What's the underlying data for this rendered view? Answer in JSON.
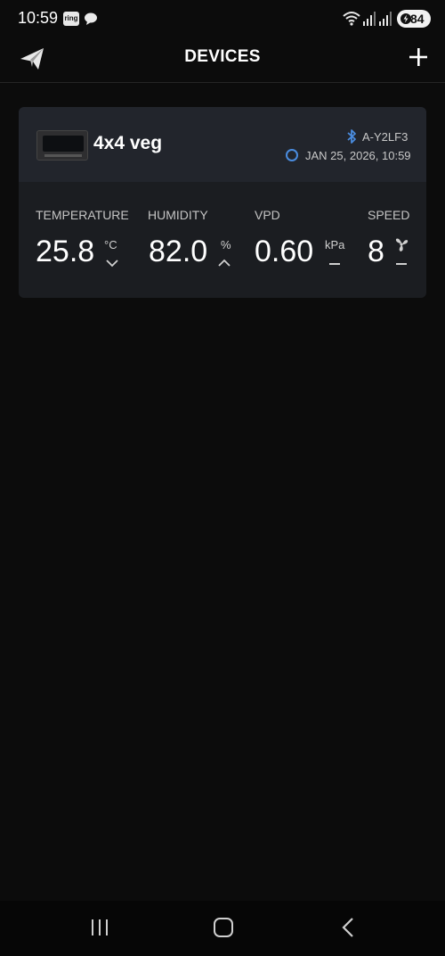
{
  "status_bar": {
    "time": "10:59",
    "ring_badge": "ring",
    "battery": "84",
    "icons": [
      "ring-icon",
      "chat-bubble-icon",
      "wifi-icon",
      "signal-icon",
      "signal-icon",
      "battery-icon"
    ]
  },
  "header": {
    "title": "DEVICES",
    "left_icon": "paper-plane-logo-icon",
    "right_icon": "plus-icon"
  },
  "device": {
    "name": "4x4 veg",
    "bluetooth_id": "A-Y2LF3",
    "last_sync": "JAN 25, 2026, 10:59",
    "metrics": {
      "temperature": {
        "label": "TEMPERATURE",
        "value": "25.8",
        "unit": "°C",
        "trend": "down"
      },
      "humidity": {
        "label": "HUMIDITY",
        "value": "82.0",
        "unit": "%",
        "trend": "up"
      },
      "vpd": {
        "label": "VPD",
        "value": "0.60",
        "unit": "kPa",
        "trend": "steady"
      },
      "speed": {
        "label": "SPEED",
        "value": "8",
        "unit_icon": "fan-icon",
        "trend": "steady"
      }
    }
  },
  "colors": {
    "background": "#0c0c0c",
    "card": "#1b1d21",
    "card_header": "#22252c",
    "accent_blue": "#4a8cdf"
  },
  "nav": {
    "icons": [
      "recents-icon",
      "home-icon",
      "back-icon"
    ]
  }
}
